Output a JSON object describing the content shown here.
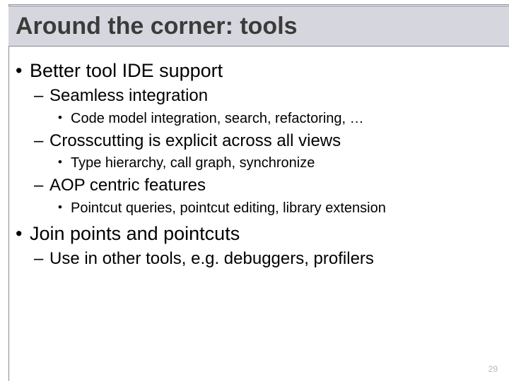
{
  "title": "Around the corner: tools",
  "bullets": {
    "b1": "Better tool IDE support",
    "b1_1": "Seamless integration",
    "b1_1_1": "Code model integration, search, refactoring, …",
    "b1_2": "Crosscutting is explicit across all views",
    "b1_2_1": "Type hierarchy, call graph, synchronize",
    "b1_3": "AOP centric features",
    "b1_3_1": "Pointcut queries, pointcut editing, library extension",
    "b2": "Join points and pointcuts",
    "b2_1": "Use in other tools, e.g. debuggers, profilers"
  },
  "page_number": "29"
}
